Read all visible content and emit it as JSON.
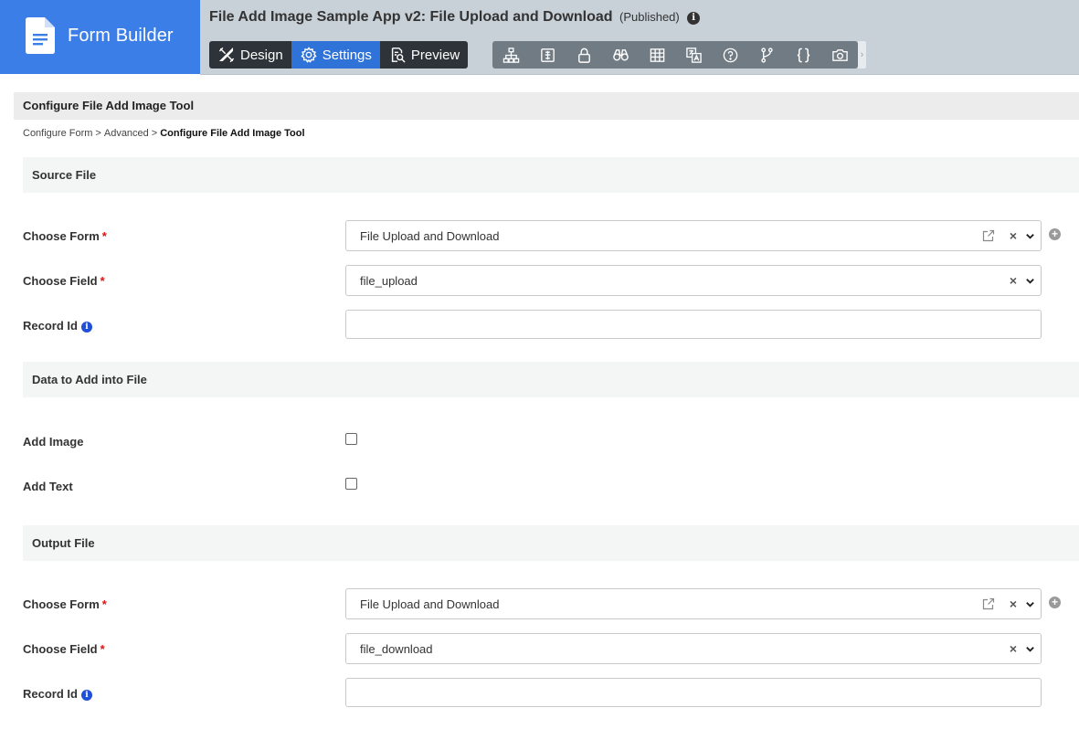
{
  "brand": {
    "name": "Form Builder",
    "icon": "document-icon",
    "color": "#3b7ee8"
  },
  "header": {
    "title": "File Add Image Sample App v2: File Upload and Download",
    "status": "(Published)",
    "info_icon": "info-icon"
  },
  "modes": [
    {
      "label": "Design",
      "icon": "design-tools-icon",
      "active": false
    },
    {
      "label": "Settings",
      "icon": "gear-icon",
      "active": true
    },
    {
      "label": "Preview",
      "icon": "preview-icon",
      "active": false
    }
  ],
  "toolbar_icons": [
    "sitemap-icon",
    "form-icon",
    "lock-icon",
    "binoculars-icon",
    "table-icon",
    "translate-icon",
    "help-icon",
    "branch-icon",
    "code-braces-icon",
    "camera-icon"
  ],
  "page": {
    "heading": "Configure File Add Image Tool",
    "breadcrumb": {
      "items": [
        "Configure Form",
        "Advanced"
      ],
      "separator": ">",
      "current": "Configure File Add Image Tool"
    }
  },
  "source": {
    "section_title": "Source File",
    "form_label": "Choose Form",
    "form_value": "File Upload and Download",
    "field_label": "Choose Field",
    "field_value": "file_upload",
    "record_label": "Record Id",
    "record_value": ""
  },
  "data_section": {
    "section_title": "Data to Add into File",
    "add_image_label": "Add Image",
    "add_image_checked": false,
    "add_text_label": "Add Text",
    "add_text_checked": false
  },
  "output": {
    "section_title": "Output File",
    "form_label": "Choose Form",
    "form_value": "File Upload and Download",
    "field_label": "Choose Field",
    "field_value": "file_download",
    "record_label": "Record Id",
    "record_value": ""
  },
  "glyphs": {
    "required": "*",
    "info": "i",
    "clear": "×",
    "add": "+",
    "scroll": "›"
  },
  "colors": {
    "accent": "#2f73d8",
    "required": "#dd1111",
    "info": "#1f4fd6"
  }
}
